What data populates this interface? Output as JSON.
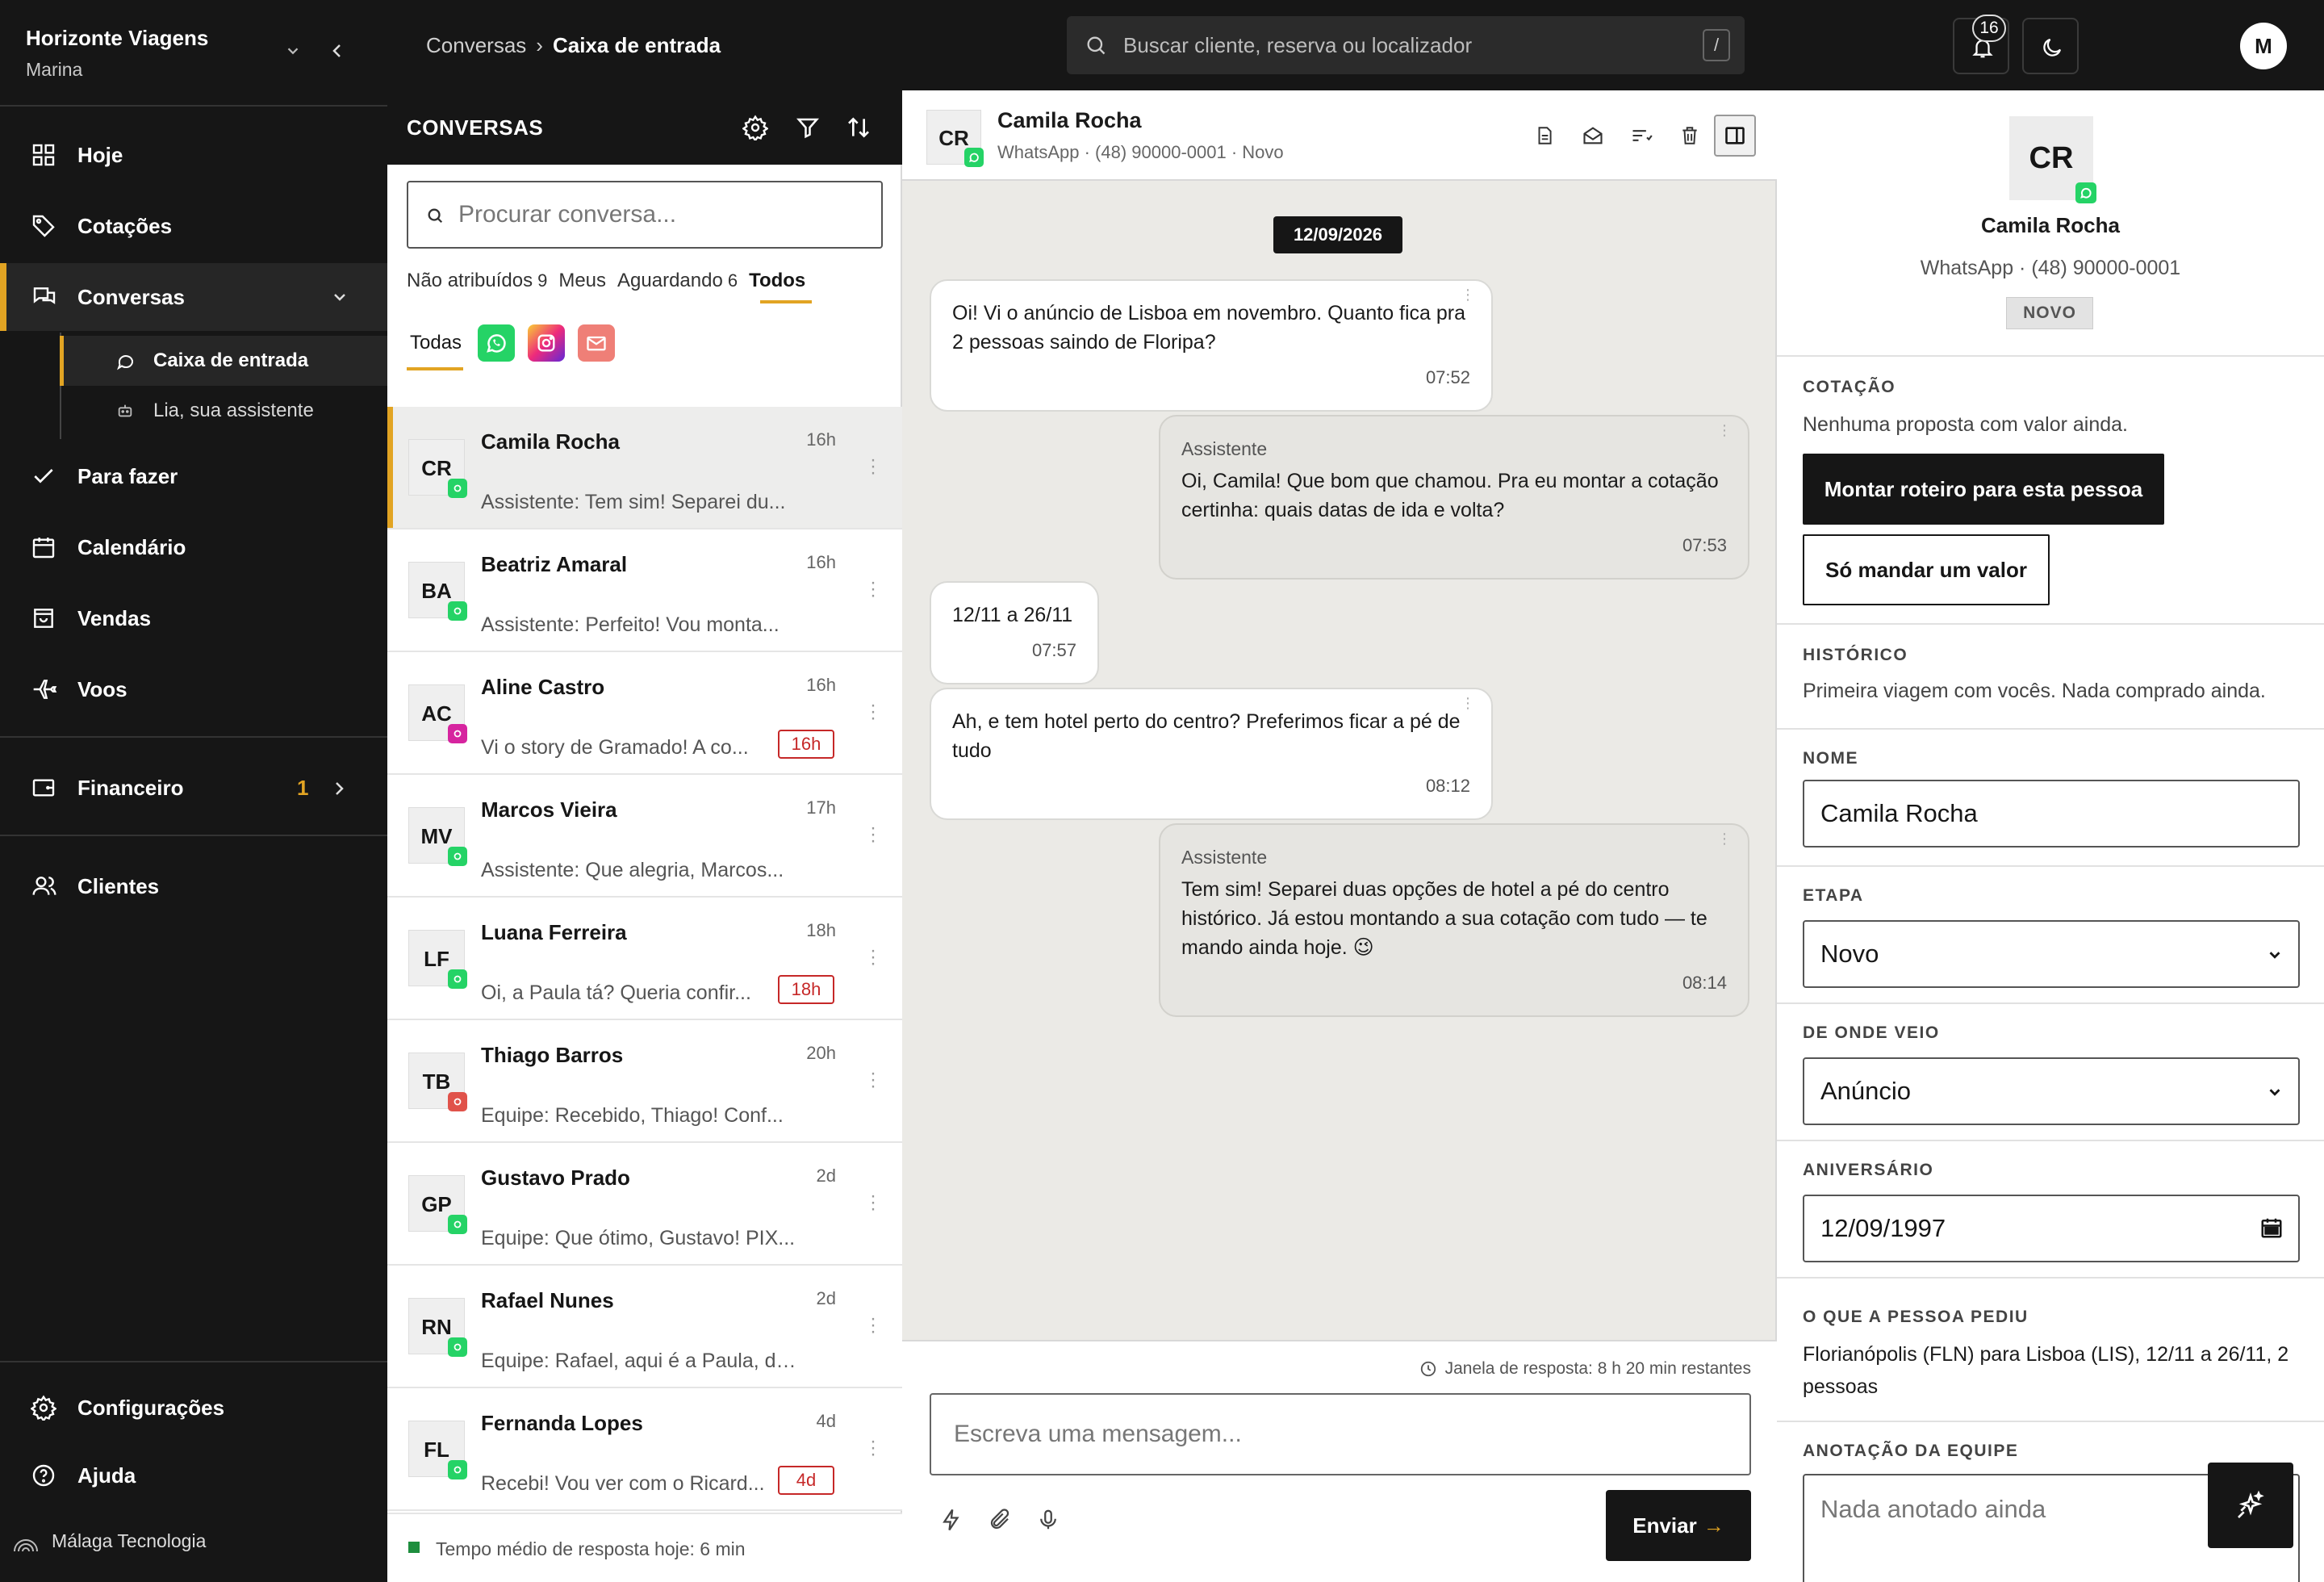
{
  "org": {
    "name": "Horizonte Viagens",
    "user": "Marina"
  },
  "nav": {
    "hoje": "Hoje",
    "cotacoes": "Cotações",
    "conversas": "Conversas",
    "caixa_entrada": "Caixa de entrada",
    "assistente": "Lia, sua assistente",
    "para_fazer": "Para fazer",
    "calendario": "Calendário",
    "vendas": "Vendas",
    "voos": "Voos",
    "financeiro": "Financeiro",
    "financeiro_count": "1",
    "clientes": "Clientes",
    "configuracoes": "Configurações",
    "ajuda": "Ajuda",
    "footer_brand": "Málaga Tecnologia"
  },
  "topbar": {
    "breadcrumb_parent": "Conversas",
    "breadcrumb_sep": "›",
    "breadcrumb_current": "Caixa de entrada",
    "search_placeholder": "Buscar cliente, reserva ou localizador",
    "search_shortcut": "/",
    "notifications": "16",
    "user_initial": "M"
  },
  "conversations": {
    "title": "CONVERSAS",
    "search_placeholder": "Procurar conversa...",
    "filters": [
      {
        "label": "Não atribuídos",
        "count": "9"
      },
      {
        "label": "Meus",
        "count": ""
      },
      {
        "label": "Aguardando",
        "count": "6"
      },
      {
        "label": "Todos",
        "count": ""
      }
    ],
    "channel_all": "Todas",
    "items": [
      {
        "initials": "CR",
        "name": "Camila Rocha",
        "time": "16h",
        "preview": "Assistente: Tem sim! Separei du...",
        "channel": "whatsapp",
        "tag": ""
      },
      {
        "initials": "BA",
        "name": "Beatriz Amaral",
        "time": "16h",
        "preview": "Assistente: Perfeito! Vou monta...",
        "channel": "whatsapp",
        "tag": ""
      },
      {
        "initials": "AC",
        "name": "Aline Castro",
        "time": "16h",
        "preview": "Vi o story de Gramado! A co...",
        "channel": "instagram",
        "tag": "16h"
      },
      {
        "initials": "MV",
        "name": "Marcos Vieira",
        "time": "17h",
        "preview": "Assistente: Que alegria, Marcos...",
        "channel": "whatsapp",
        "tag": ""
      },
      {
        "initials": "LF",
        "name": "Luana Ferreira",
        "time": "18h",
        "preview": "Oi, a Paula tá? Queria confir...",
        "channel": "whatsapp",
        "tag": "18h"
      },
      {
        "initials": "TB",
        "name": "Thiago Barros",
        "time": "20h",
        "preview": "Equipe: Recebido, Thiago! Conf...",
        "channel": "email",
        "tag": ""
      },
      {
        "initials": "GP",
        "name": "Gustavo Prado",
        "time": "2d",
        "preview": "Equipe: Que ótimo, Gustavo! PIX...",
        "channel": "whatsapp",
        "tag": ""
      },
      {
        "initials": "RN",
        "name": "Rafael Nunes",
        "time": "2d",
        "preview": "Equipe: Rafael, aqui é a Paula, da...",
        "channel": "whatsapp",
        "tag": ""
      },
      {
        "initials": "FL",
        "name": "Fernanda Lopes",
        "time": "4d",
        "preview": "Recebi! Vou ver com o Ricard...",
        "channel": "whatsapp",
        "tag": "4d"
      }
    ],
    "footer": "Tempo médio de resposta hoje: 6 min"
  },
  "chat": {
    "initials": "CR",
    "name": "Camila Rocha",
    "subtitle": "WhatsApp · (48) 90000-0001 · Novo",
    "date": "12/09/2026",
    "messages": [
      {
        "dir": "in",
        "author": "",
        "text": "Oi! Vi o anúncio de Lisboa em novembro. Quanto fica pra 2 pessoas saindo de Floripa?",
        "time": "07:52"
      },
      {
        "dir": "out",
        "author": "Assistente",
        "text": "Oi, Camila! Que bom que chamou. Pra eu montar a cotação certinha: quais datas de ida e volta?",
        "time": "07:53"
      },
      {
        "dir": "in",
        "author": "",
        "text": "12/11 a 26/11",
        "time": "07:57"
      },
      {
        "dir": "in",
        "author": "",
        "text": "Ah, e tem hotel perto do centro? Preferimos ficar a pé de tudo",
        "time": "08:12"
      },
      {
        "dir": "out",
        "author": "Assistente",
        "text": "Tem sim! Separei duas opções de hotel a pé do centro histórico. Já estou montando a sua cotação com tudo — te mando ainda hoje. 😉",
        "time": "08:14"
      }
    ],
    "window_text": "Janela de resposta: 8 h 20 min restantes",
    "composer_placeholder": "Escreva uma mensagem...",
    "send_label": "Enviar",
    "send_arrow": "→"
  },
  "details": {
    "initials": "CR",
    "name": "Camila Rocha",
    "subtitle": "WhatsApp · (48) 90000-0001",
    "badge": "NOVO",
    "cotacao_label": "COTAÇÃO",
    "cotacao_text": "Nenhuma proposta com valor ainda.",
    "btn_roteiro": "Montar roteiro para esta pessoa",
    "btn_valor": "Só mandar um valor",
    "historico_label": "HISTÓRICO",
    "historico_text": "Primeira viagem com vocês. Nada comprado ainda.",
    "nome_label": "NOME",
    "nome_value": "Camila Rocha",
    "etapa_label": "ETAPA",
    "etapa_value": "Novo",
    "origem_label": "DE ONDE VEIO",
    "origem_value": "Anúncio",
    "aniversario_label": "ANIVERSÁRIO",
    "aniversario_value": "12/09/1997",
    "pedido_label": "O QUE A PESSOA PEDIU",
    "pedido_text": "Florianópolis (FLN) para Lisboa (LIS), 12/11 a 26/11, 2 pessoas",
    "anotacao_label": "ANOTAÇÃO DA EQUIPE",
    "anotacao_placeholder": "Nada anotado ainda"
  },
  "colors": {
    "accent": "#e2a423",
    "dark": "#161616",
    "whatsapp": "#25d366",
    "instagram": "#d6249f",
    "email": "#e0524a",
    "alert": "#c62828"
  }
}
